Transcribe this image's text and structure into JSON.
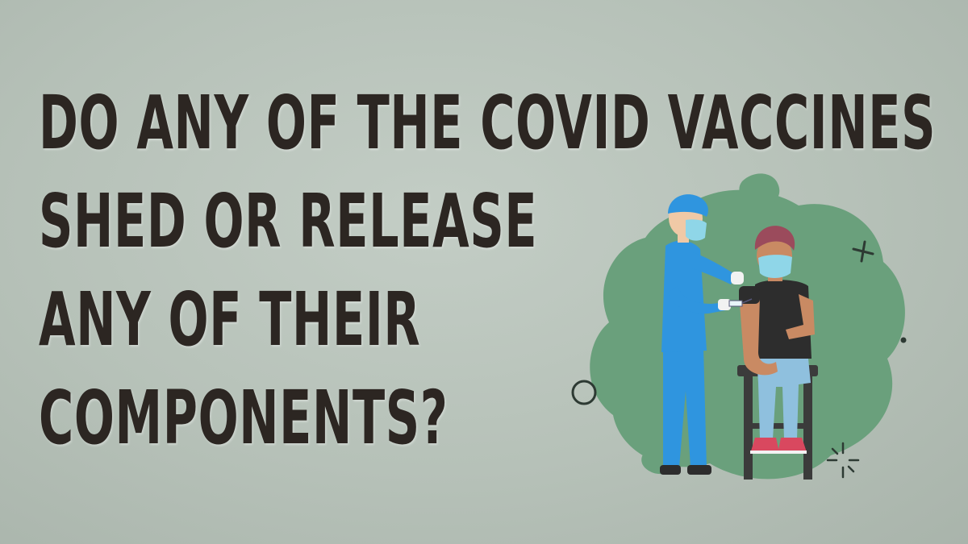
{
  "headline": {
    "lines": [
      "DO ANY OF THE COVID VACCINES",
      "SHED OR RELEASE",
      "ANY OF THEIR",
      "COMPONENTS?"
    ]
  },
  "colors": {
    "background": "#b9c4bb",
    "text": "#2c2622",
    "blob": "#6aa07c",
    "scrubs": "#2f95df",
    "shirt": "#2d2d2d",
    "jeans": "#8fc0de"
  },
  "illustration": {
    "subject": "nurse-vaccinating-patient"
  }
}
